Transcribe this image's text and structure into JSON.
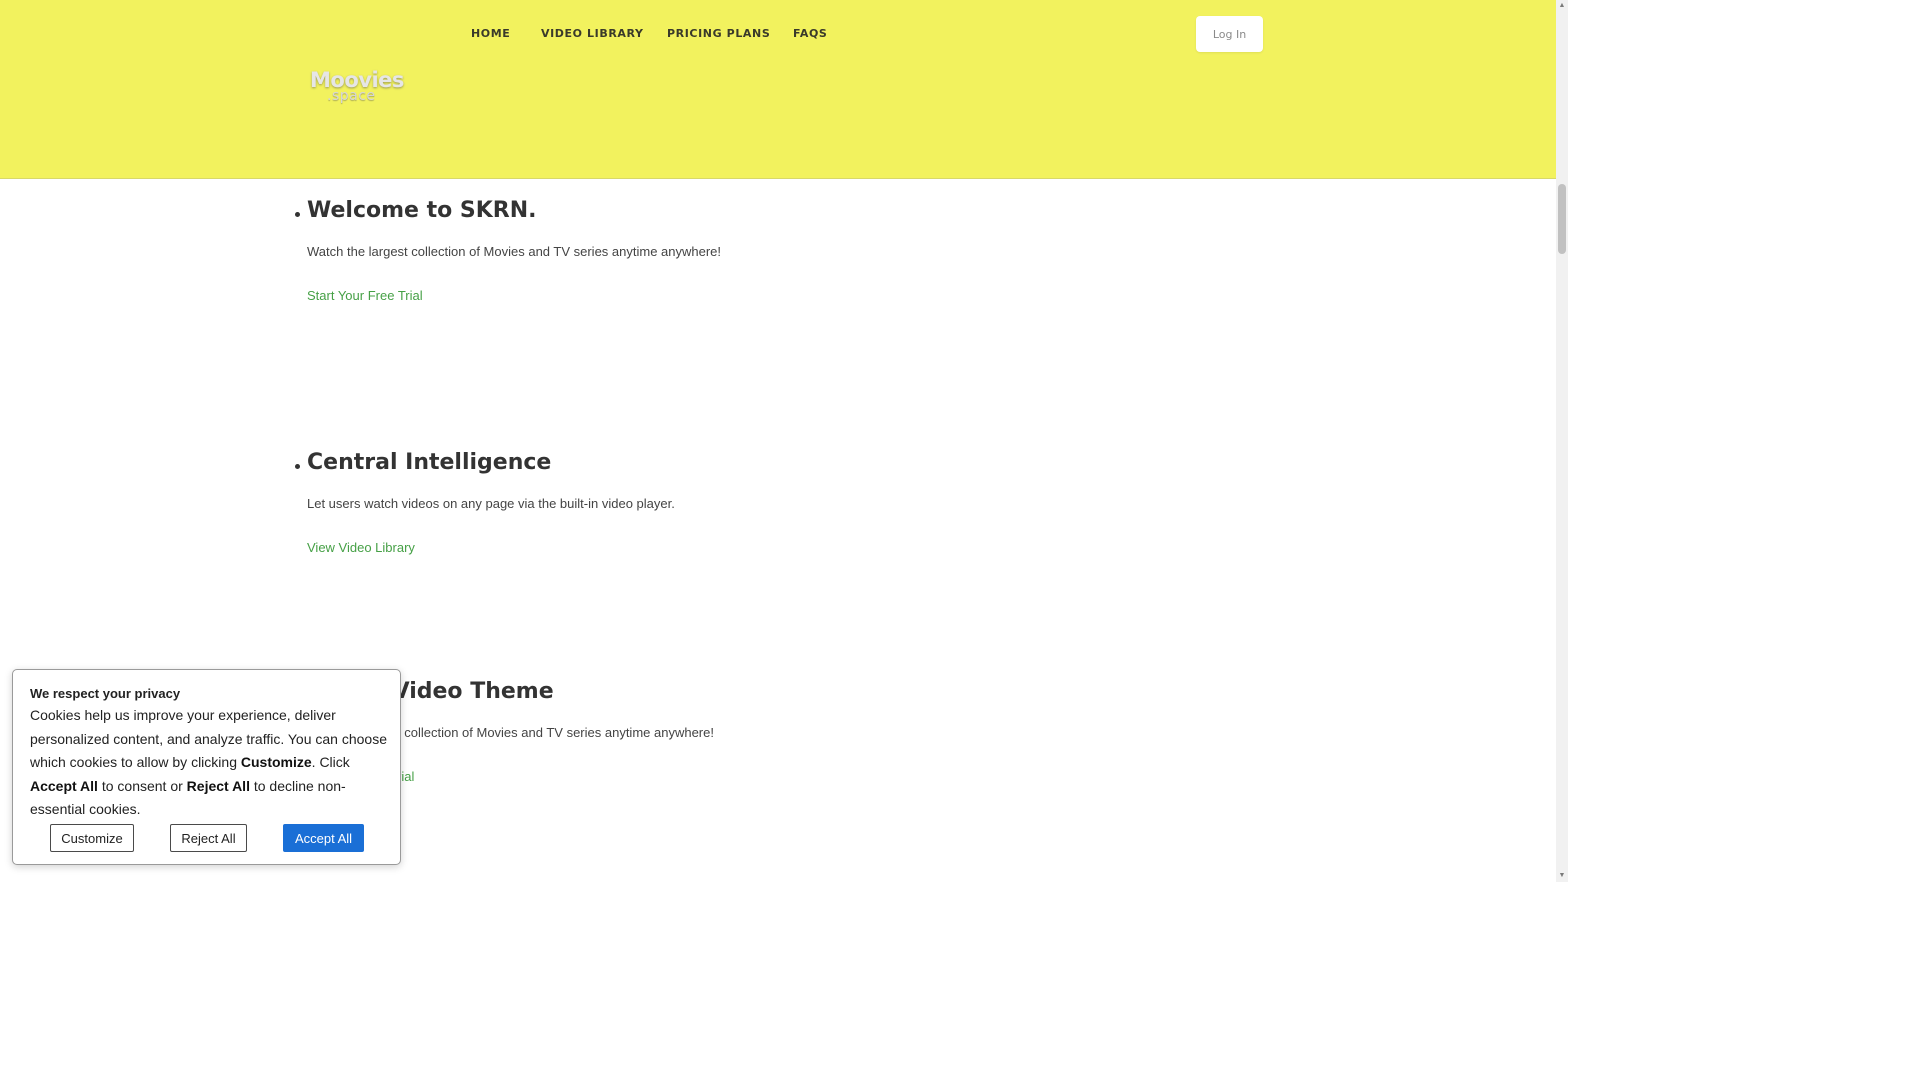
{
  "header": {
    "nav": [
      {
        "label": "HOME"
      },
      {
        "label": "VIDEO LIBRARY"
      },
      {
        "label": "PRICING PLANS"
      },
      {
        "label": "FAQS"
      }
    ],
    "login_label": "Log In",
    "logo": {
      "line1": "Moovies",
      "line2": ".space"
    },
    "background_color": "#f2f25e"
  },
  "slides": [
    {
      "title": "Welcome to SKRN.",
      "description": "Watch the largest collection of Movies and TV series anytime anywhere!",
      "link": "Start Your Free Trial"
    },
    {
      "title": "Central Intelligence",
      "description": "Let users watch videos on any page via the built-in video player.",
      "link": "View Video Library"
    },
    {
      "title": "e Video Theme",
      "description": "t collection of Movies and TV series anytime anywhere!",
      "link": "rial"
    }
  ],
  "cookie_banner": {
    "title": "We respect your privacy",
    "text_part1": "Cookies help us improve your experience, deliver personalized content, and analyze traffic. You can choose which cookies to allow by clicking ",
    "text_customize": "Customize",
    "text_part2": ". Click ",
    "text_accept": "Accept All",
    "text_part3": " to consent or ",
    "text_reject": "Reject All",
    "text_part4": " to decline non-essential cookies.",
    "buttons": {
      "customize": "Customize",
      "reject": "Reject All",
      "accept": "Accept All"
    },
    "accent_color": "#1a6fd6"
  },
  "colors": {
    "link": "#46a046"
  },
  "icons": {
    "scroll_up": "triangle-up-icon",
    "scroll_down": "triangle-down-icon"
  }
}
